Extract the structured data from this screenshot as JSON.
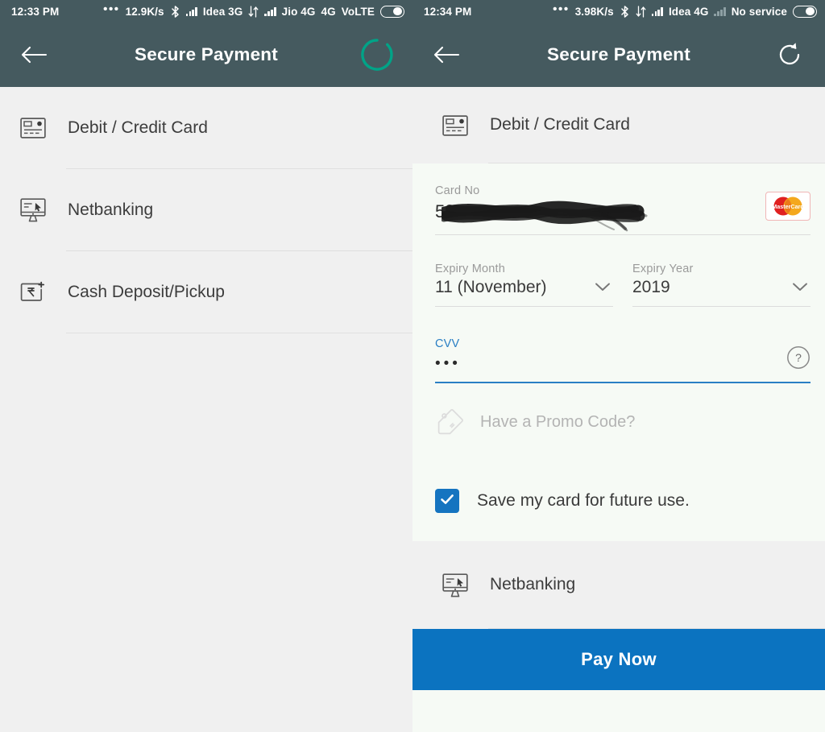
{
  "colors": {
    "appbar": "#455a5f",
    "page_bg": "#f0f0f0",
    "form_bg": "#f6faf5",
    "accent_blue": "#1574c0",
    "pay_button": "#0b73c0",
    "spinner_teal": "#00a387",
    "focus_blue": "#2a7fc4"
  },
  "left": {
    "statusbar": {
      "time": "12:33 PM",
      "overflow_icon": "•••",
      "network_speed": "12.9K/s",
      "bluetooth_icon": "bluetooth-icon",
      "signal_one_icon": "signal-bars-icon",
      "carrier_one": "Idea 3G",
      "data_transfer_icon": "data-transfer-icon",
      "signal_two_icon": "signal-bars-icon",
      "carrier_two": "Jio 4G",
      "network_type": "4G",
      "volte": "VoLTE",
      "battery_icon": "battery-icon"
    },
    "appbar": {
      "back_icon": "back-arrow-icon",
      "title": "Secure Payment",
      "action_icon": "loading-spinner-icon"
    },
    "methods": [
      {
        "icon": "credit-card-icon",
        "label": "Debit / Credit Card"
      },
      {
        "icon": "monitor-netbanking-icon",
        "label": "Netbanking"
      },
      {
        "icon": "cash-deposit-rupee-icon",
        "label": "Cash Deposit/Pickup"
      }
    ]
  },
  "right": {
    "statusbar": {
      "time": "12:34 PM",
      "overflow_icon": "•••",
      "network_speed": "3.98K/s",
      "bluetooth_icon": "bluetooth-icon",
      "data_transfer_icon": "data-transfer-icon",
      "signal_one_icon": "signal-bars-icon",
      "carrier_one": "Idea 4G",
      "signal_two_icon": "signal-bars-no-service-icon",
      "carrier_two": "No service",
      "battery_icon": "battery-icon"
    },
    "appbar": {
      "back_icon": "back-arrow-icon",
      "title": "Secure Payment",
      "action_icon": "refresh-icon"
    },
    "card_section": {
      "header_icon": "credit-card-icon",
      "header_label": "Debit / Credit Card",
      "card_no": {
        "label": "Card No",
        "value": "5",
        "redacted": true,
        "brand_icon": "mastercard-logo",
        "brand_name": "MasterCard"
      },
      "expiry_month": {
        "label": "Expiry Month",
        "value": "11 (November)",
        "chevron_icon": "chevron-down-icon"
      },
      "expiry_year": {
        "label": "Expiry Year",
        "value": "2019",
        "chevron_icon": "chevron-down-icon"
      },
      "cvv": {
        "label": "CVV",
        "value": "•••",
        "focused": true,
        "help_icon": "help-circle-icon"
      },
      "promo": {
        "icon": "promo-tag-icon",
        "placeholder": "Have a Promo Code?"
      },
      "save_card": {
        "checked": true,
        "check_icon": "checkmark-icon",
        "label": "Save my card for future use."
      }
    },
    "other_methods": [
      {
        "icon": "monitor-netbanking-icon",
        "label": "Netbanking"
      }
    ],
    "pay_button": {
      "label": "Pay Now"
    }
  }
}
